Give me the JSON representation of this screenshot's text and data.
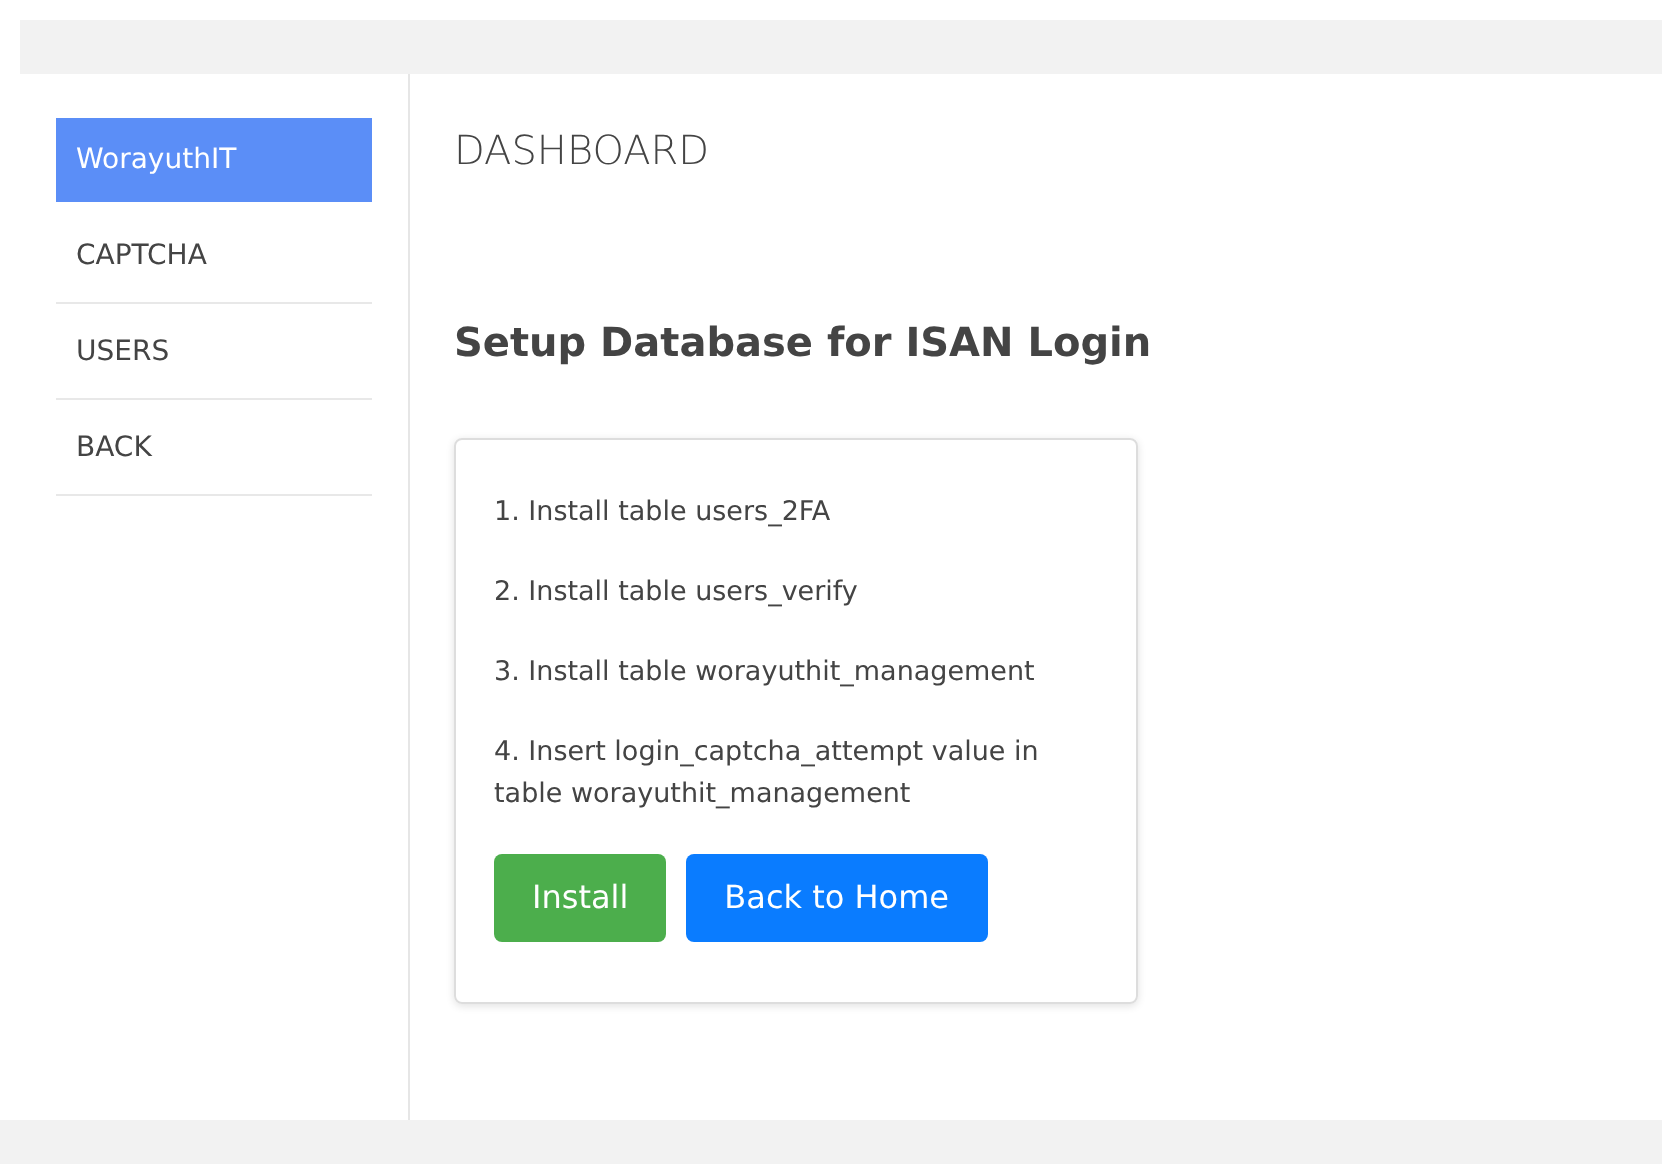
{
  "sidebar": {
    "items": [
      {
        "label": "WorayuthIT",
        "selected": true
      },
      {
        "label": "CAPTCHA",
        "selected": false
      },
      {
        "label": "USERS",
        "selected": false
      },
      {
        "label": "BACK",
        "selected": false
      }
    ]
  },
  "page_title": "DASHBOARD",
  "heading": "Setup Database for ISAN Login",
  "card": {
    "steps": [
      "1. Install table users_2FA",
      "2. Install table users_verify",
      "3. Install table worayuthit_management",
      "4. Insert login_captcha_attempt value in table worayuthit_management"
    ],
    "buttons": [
      {
        "label": "Install",
        "kind": "success"
      },
      {
        "label": "Back to Home",
        "kind": "primary"
      }
    ]
  }
}
